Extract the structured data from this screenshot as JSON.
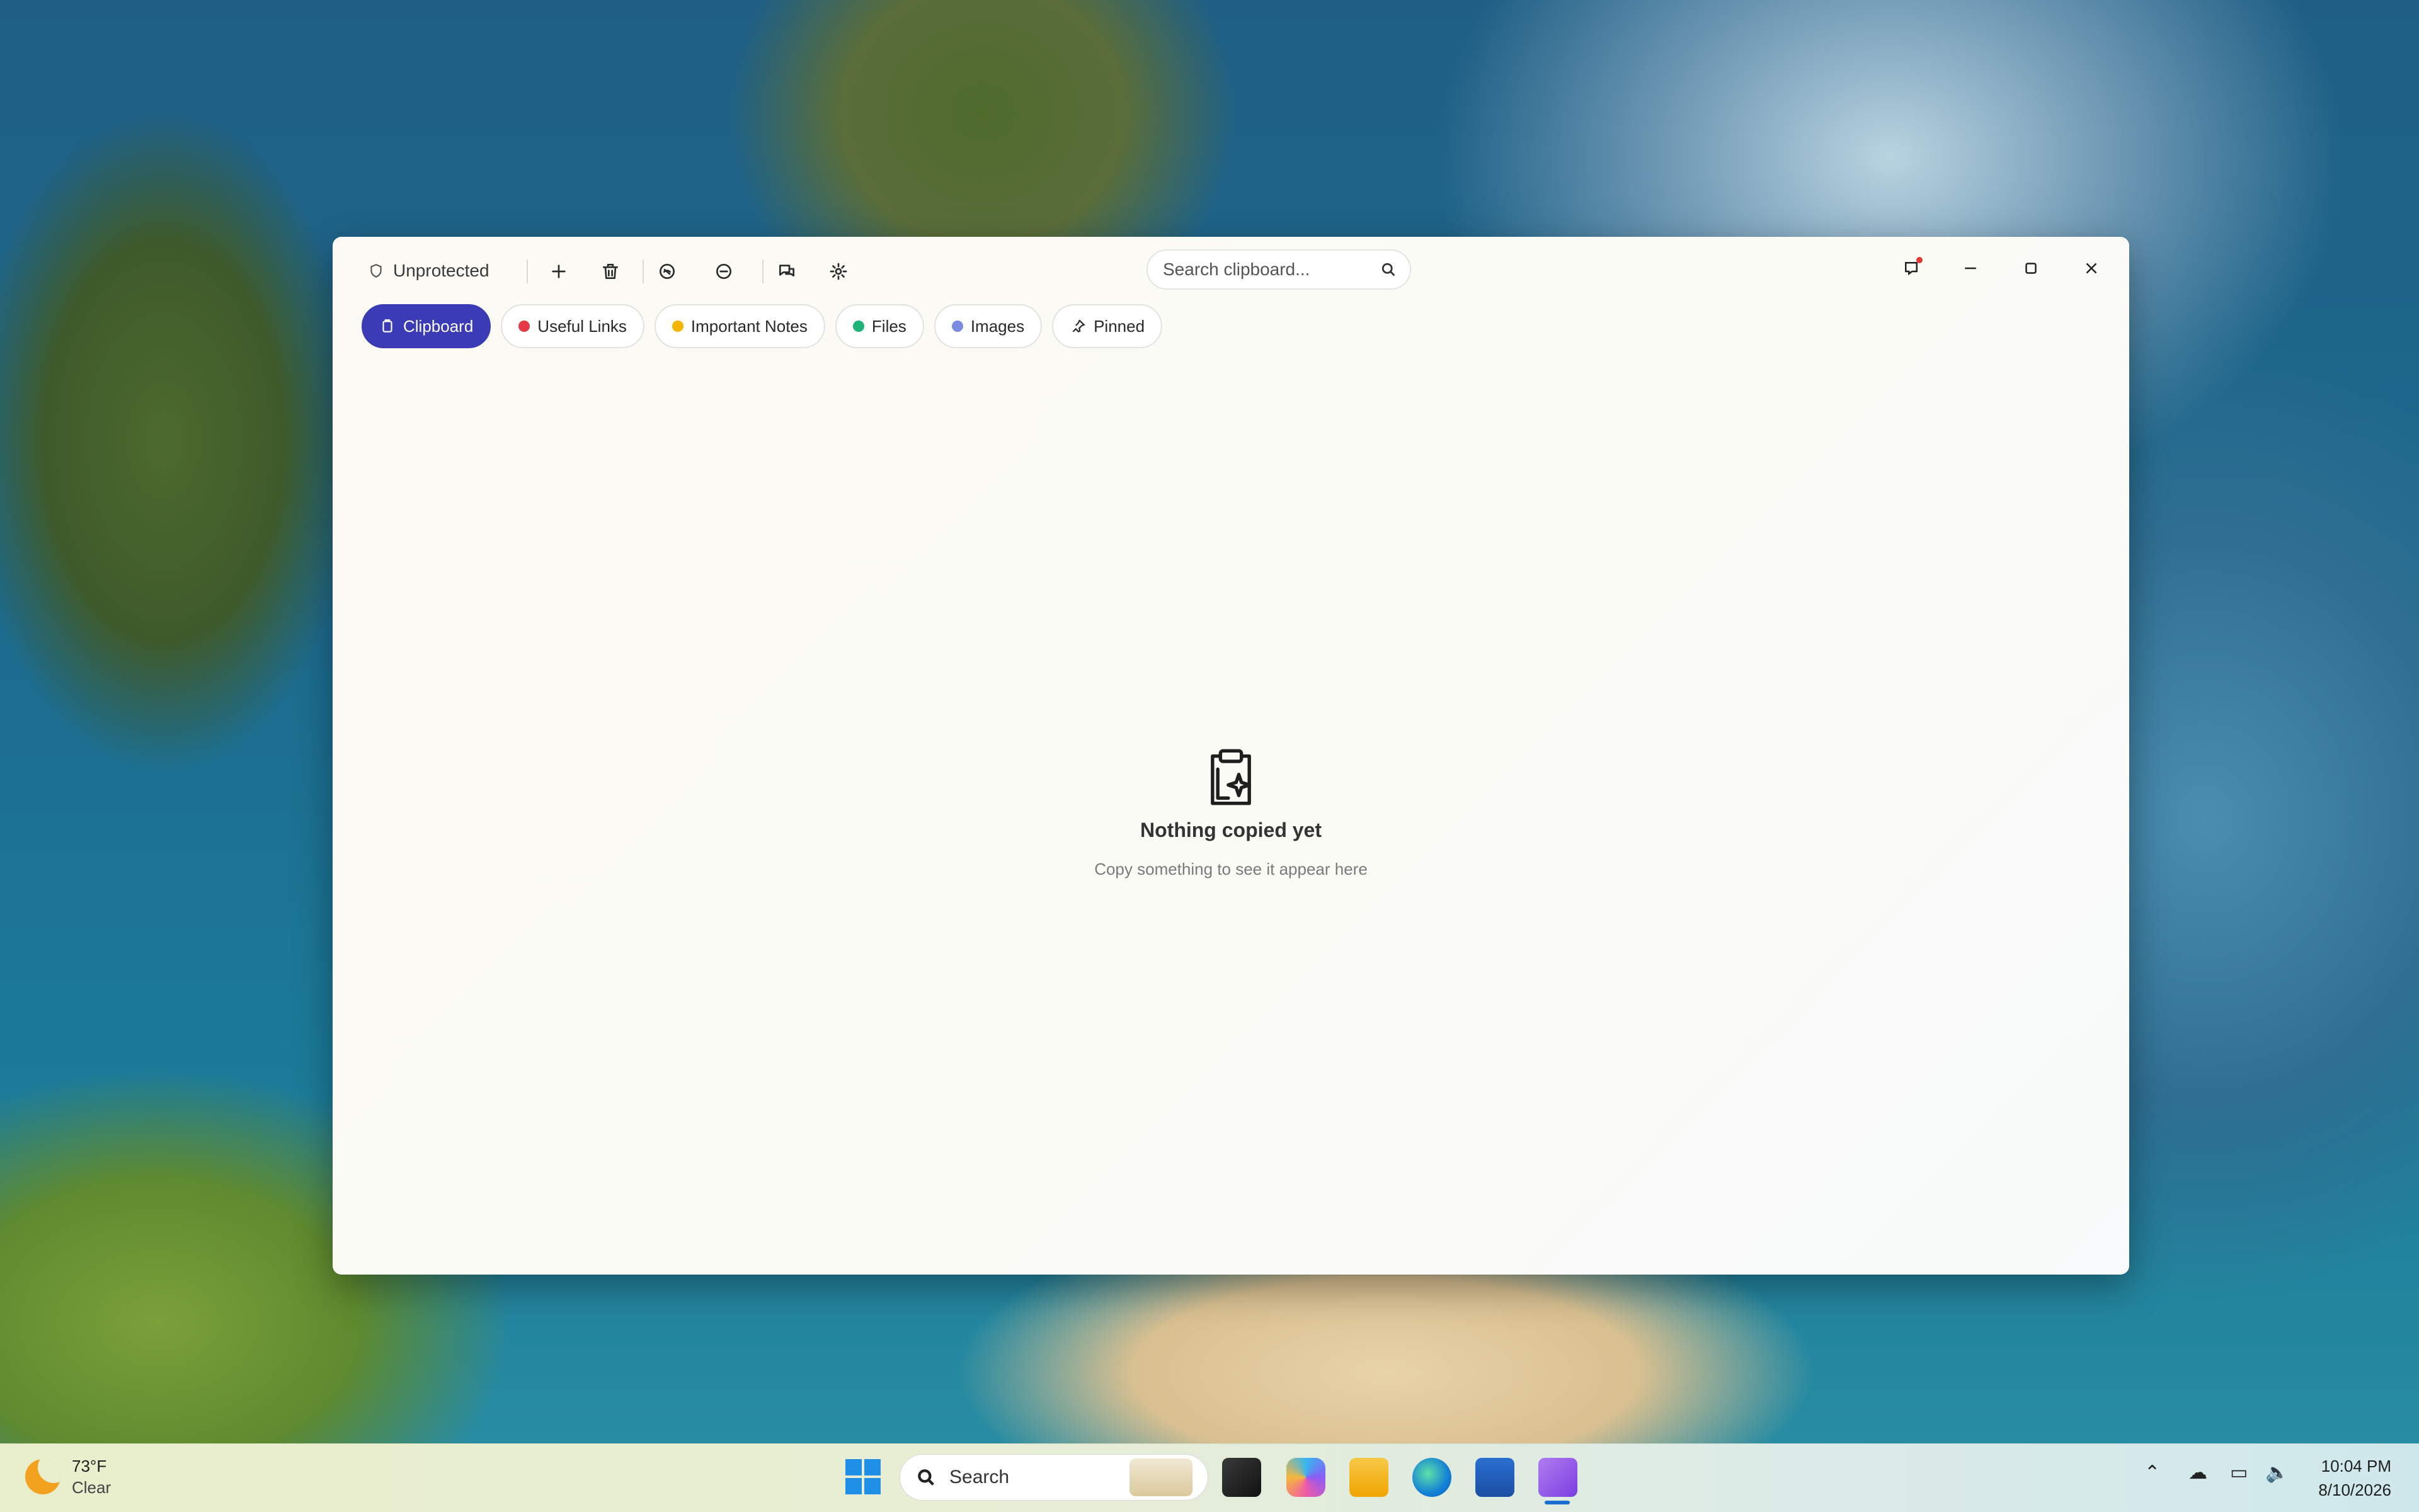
{
  "window": {
    "protection_status": "Unprotected",
    "search": {
      "placeholder": "Search clipboard..."
    },
    "toolbar_icons": [
      "shield-icon",
      "plus-icon",
      "trash-icon",
      "clear-icon",
      "minus-circle-icon",
      "chat-icon",
      "gear-icon"
    ],
    "tabs": [
      {
        "label": "Clipboard",
        "active": true,
        "icon": "clipboard-icon"
      },
      {
        "label": "Useful Links",
        "color": "#e53945"
      },
      {
        "label": "Important Notes",
        "color": "#f4b400"
      },
      {
        "label": "Files",
        "color": "#1fb37a"
      },
      {
        "label": "Images",
        "color": "#7b8be0"
      },
      {
        "label": "Pinned",
        "icon": "pin-icon"
      }
    ],
    "empty_state": {
      "title": "Nothing copied yet",
      "subtitle": "Copy something to see it appear here"
    },
    "accent_color": "#3a3bb5"
  },
  "taskbar": {
    "weather": {
      "temp": "73°F",
      "condition": "Clear"
    },
    "search_label": "Search",
    "clock": {
      "time": "10:04 PM",
      "date": "8/10/2026"
    }
  }
}
